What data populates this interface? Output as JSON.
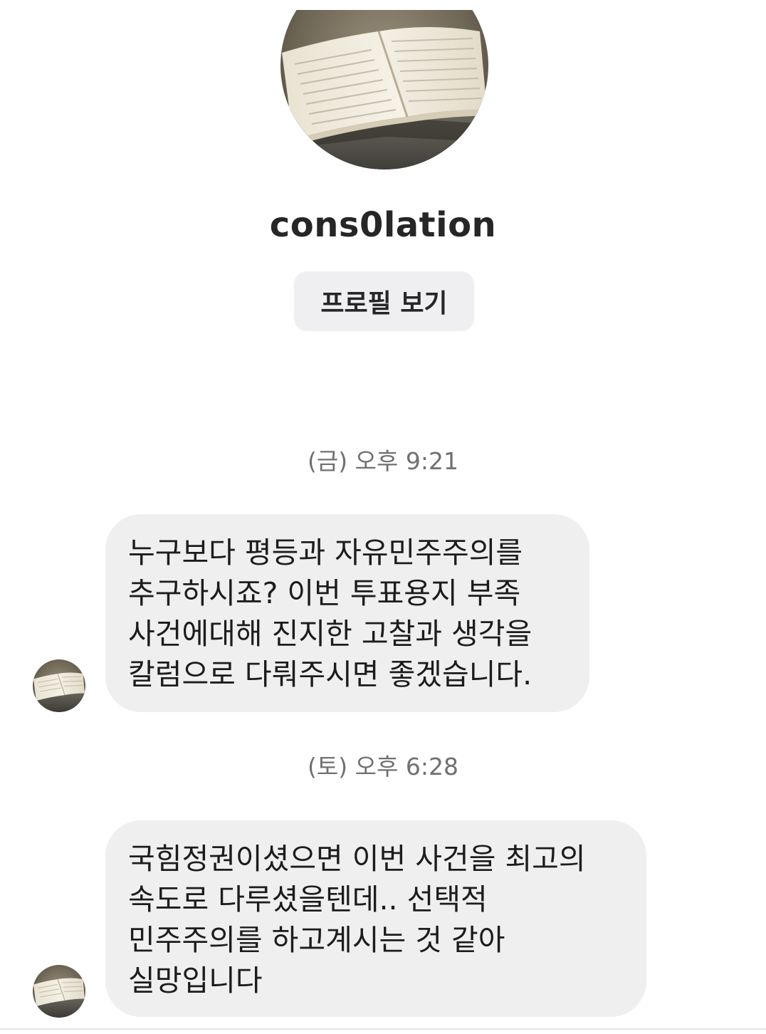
{
  "profile": {
    "avatar_icon": "open-book-photo",
    "username": "cons0lation",
    "view_profile_label": "프로필 보기"
  },
  "messages": [
    {
      "timestamp": "(금) 오후 9:21",
      "lines": [
        "누구보다 평등과 자유민주주의를",
        "추구하시죠? 이번 투표용지 부족",
        "사건에대해 진지한 고찰과 생각을",
        "칼럼으로 다뤄주시면 좋겠습니다."
      ]
    },
    {
      "timestamp": "(토) 오후 6:28",
      "lines": [
        "국힘정권이셨으면 이번 사건을 최고의",
        "속도로 다루셨을텐데..  선택적",
        "민주주의를 하고계시는 것 같아",
        "실망입니다"
      ]
    }
  ],
  "colors": {
    "bubble_background": "#efeff0",
    "button_background": "#efeff1",
    "timestamp_text": "#707070"
  }
}
